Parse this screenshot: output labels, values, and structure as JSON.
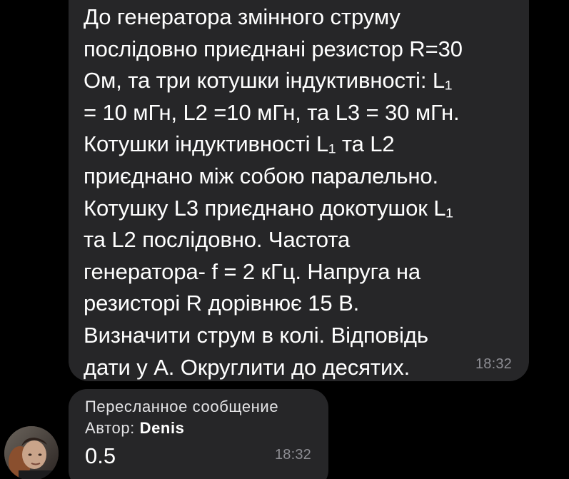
{
  "messages": [
    {
      "text": "До генератора змінного струму\nпослідовно приєднані резистор R=30\nОм, та  три  котушки індуктивності: L₁\n= 10 мГн,  L2 =10 мГн, та L3 = 30 мГн.\nКотушки індуктивності L₁ та L2\nприєднано між собою паралельно.\nКотушку L3 приєднано докотушок L₁\nта L2 послідовно. Частота\nгенератора- f =  2 кГц.  Напруга на\nрезисторі   R  дорівнює  15 В.\nВизначити струм в колі. Відповідь\nдати у А. Округлити до десятих.",
      "time": "18:32"
    },
    {
      "forwarded_label": "Пересланное сообщение",
      "author_label": "Автор: ",
      "author_name": "Denis",
      "text": "0.5",
      "time": "18:32",
      "avatar_icon": "user-avatar"
    }
  ],
  "colors": {
    "background": "#000000",
    "bubble": "#262628",
    "timestamp": "#8d8d93"
  }
}
